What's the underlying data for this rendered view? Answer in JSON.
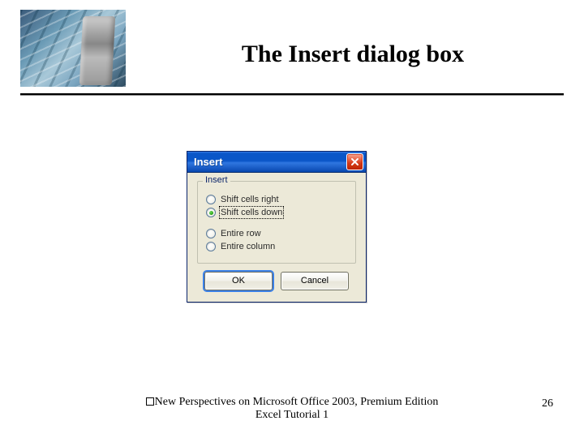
{
  "slide": {
    "title": "The Insert dialog box",
    "footer_line1": "New Perspectives on Microsoft Office 2003, Premium Edition",
    "footer_line2": "Excel Tutorial 1",
    "page_number": "26"
  },
  "dialog": {
    "title": "Insert",
    "group_label": "Insert",
    "options": [
      {
        "label": "Shift cells right",
        "checked": false,
        "focused": false
      },
      {
        "label": "Shift cells down",
        "checked": true,
        "focused": true
      },
      {
        "label": "Entire row",
        "checked": false,
        "focused": false
      },
      {
        "label": "Entire column",
        "checked": false,
        "focused": false
      }
    ],
    "ok_label": "OK",
    "cancel_label": "Cancel"
  }
}
